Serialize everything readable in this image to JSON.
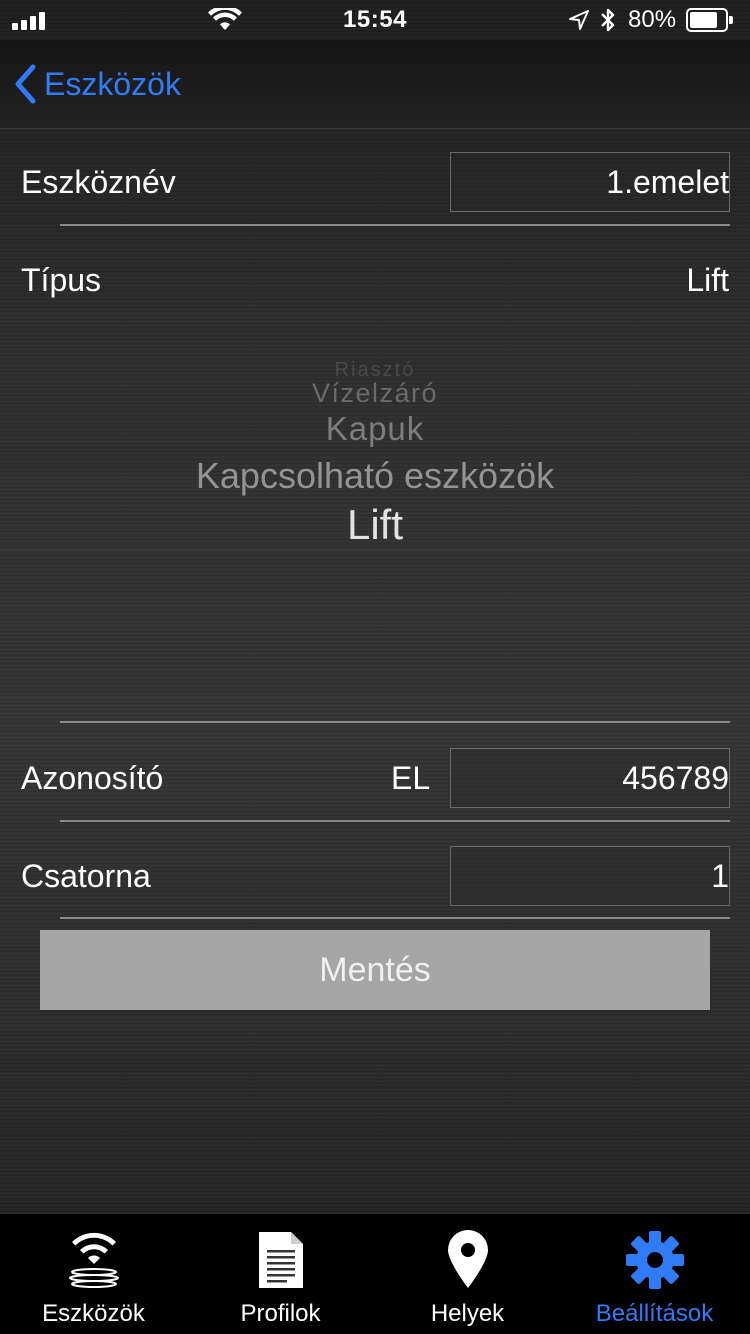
{
  "status_bar": {
    "time": "15:54",
    "battery_percent": "80%",
    "battery_level": 0.8,
    "icons": [
      "signal-icon",
      "wifi-icon",
      "location-icon",
      "bluetooth-icon",
      "battery-icon"
    ]
  },
  "nav": {
    "back_label": "Eszközök"
  },
  "form": {
    "device_name_label": "Eszköznév",
    "device_name_value": "1.emelet",
    "type_label": "Típus",
    "type_value": "Lift",
    "id_label": "Azonosító",
    "id_prefix": "EL",
    "id_value": "456789",
    "channel_label": "Csatorna",
    "channel_value": "1"
  },
  "picker": {
    "items": [
      "",
      "Riasztó",
      "Vízelzáró",
      "Kapuk",
      "Kapcsolható eszközök",
      "Lift"
    ],
    "selected": "Lift"
  },
  "save_label": "Mentés",
  "tabs": [
    {
      "label": "Eszközök",
      "icon": "wifi-devices-icon",
      "active": false
    },
    {
      "label": "Profilok",
      "icon": "document-icon",
      "active": false
    },
    {
      "label": "Helyek",
      "icon": "location-pin-icon",
      "active": false
    },
    {
      "label": "Beállítások",
      "icon": "gear-icon",
      "active": true
    }
  ],
  "colors": {
    "accent": "#2f7cf6",
    "save_button_bg": "#a5a5a5",
    "tab_bar_bg": "#000000"
  }
}
